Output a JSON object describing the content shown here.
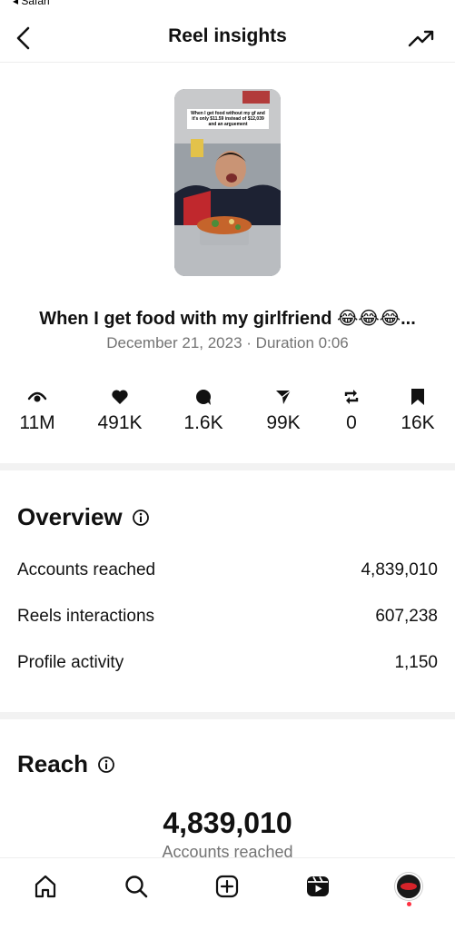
{
  "status_bar": {
    "back_app": "◂ Safari"
  },
  "header": {
    "title": "Reel insights"
  },
  "reel": {
    "thumbnail_caption": "When I get food without my gf and it's only $11.59 instead of $12,039 and an arguement",
    "title": "When I get food with my girlfriend 😂😂😂...",
    "date": "December 21, 2023",
    "separator": " · ",
    "duration": "Duration 0:06"
  },
  "metrics": [
    {
      "icon": "eye-icon",
      "value": "11M"
    },
    {
      "icon": "heart-icon",
      "value": "491K"
    },
    {
      "icon": "comment-icon",
      "value": "1.6K"
    },
    {
      "icon": "share-icon",
      "value": "99K"
    },
    {
      "icon": "repost-icon",
      "value": "0"
    },
    {
      "icon": "bookmark-icon",
      "value": "16K"
    }
  ],
  "overview": {
    "title": "Overview",
    "rows": [
      {
        "label": "Accounts reached",
        "value": "4,839,010"
      },
      {
        "label": "Reels interactions",
        "value": "607,238"
      },
      {
        "label": "Profile activity",
        "value": "1,150"
      }
    ]
  },
  "reach": {
    "title": "Reach",
    "big_value": "4,839,010",
    "big_label": "Accounts reached"
  },
  "tab_bar": {
    "items": [
      "home-icon",
      "search-icon",
      "create-icon",
      "reels-icon",
      "profile-avatar"
    ]
  },
  "colors": {
    "secondary_text": "#737373",
    "notification_dot": "#ff3040"
  }
}
